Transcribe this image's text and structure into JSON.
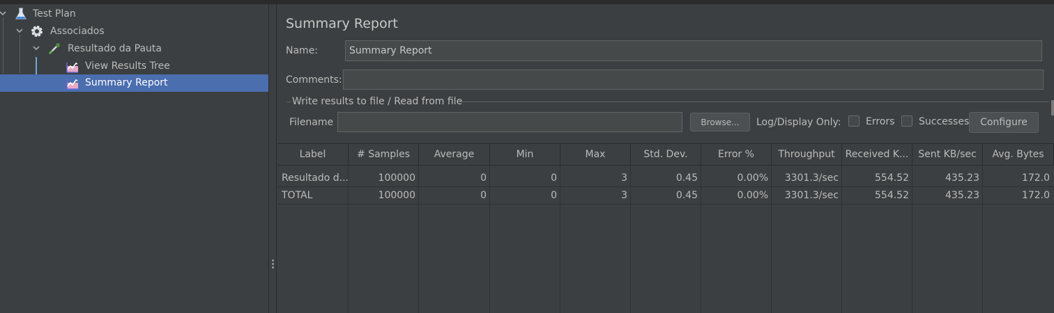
{
  "tree": {
    "items": [
      {
        "label": "Test Plan",
        "icon": "flask-icon"
      },
      {
        "label": "Associados",
        "icon": "gear-icon"
      },
      {
        "label": "Resultado da Pauta",
        "icon": "pipette-icon"
      },
      {
        "label": "View Results Tree",
        "icon": "graph-listener-icon"
      },
      {
        "label": "Summary Report",
        "icon": "graph-listener-icon",
        "selected": true
      }
    ]
  },
  "panel": {
    "title": "Summary Report",
    "name_label": "Name:",
    "name_value": "Summary Report",
    "comments_label": "Comments:",
    "comments_value": "",
    "file_group_label": "Write results to file / Read from file",
    "filename_label": "Filename",
    "filename_value": "",
    "browse_label": "Browse...",
    "log_display_label": "Log/Display Only:",
    "errors_label": "Errors",
    "successes_label": "Successes",
    "configure_label": "Configure"
  },
  "table": {
    "columns": [
      "Label",
      "# Samples",
      "Average",
      "Min",
      "Max",
      "Std. Dev.",
      "Error %",
      "Throughput",
      "Received K...",
      "Sent KB/sec",
      "Avg. Bytes"
    ],
    "rows": [
      [
        "Resultado d...",
        "100000",
        "0",
        "0",
        "3",
        "0.45",
        "0.00%",
        "3301.3/sec",
        "554.52",
        "435.23",
        "172.0"
      ],
      [
        "TOTAL",
        "100000",
        "0",
        "0",
        "3",
        "0.45",
        "0.00%",
        "3301.3/sec",
        "554.52",
        "435.23",
        "172.0"
      ]
    ]
  },
  "colors": {
    "background": "#3c3f41",
    "selection": "#4b6eaf",
    "field": "#45494a"
  }
}
